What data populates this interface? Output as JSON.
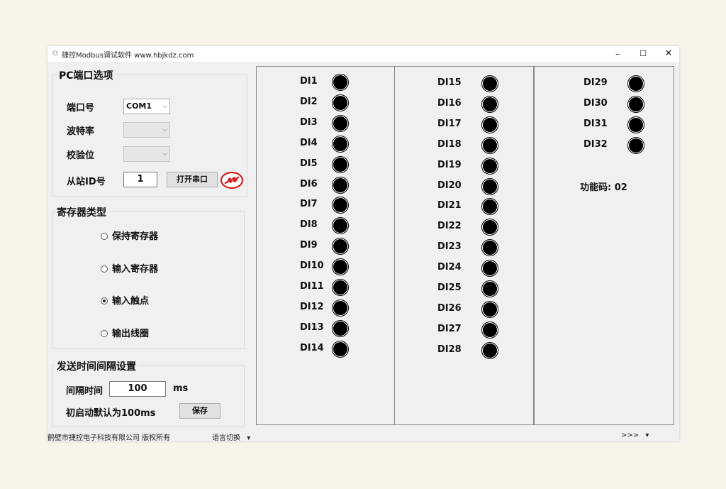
{
  "window": {
    "title": "捷控Modbus调试软件 www.hbjkdz.com",
    "icon": "app-icon",
    "controls": {
      "minimize": "–",
      "maximize": "☐",
      "close": "✕"
    }
  },
  "port_group": {
    "title": "PC端口选项",
    "port_label": "端口号",
    "port_value": "COM1",
    "baud_label": "波特率",
    "baud_value": "",
    "parity_label": "校验位",
    "parity_value": "",
    "slave_label": "从站ID号",
    "slave_value": "1",
    "open_button": "打开串口",
    "connection_icon": "disconnected-plug-icon"
  },
  "register_group": {
    "title": "寄存器类型",
    "options": [
      {
        "label": "保持寄存器",
        "checked": false
      },
      {
        "label": "输入寄存器",
        "checked": false
      },
      {
        "label": "输入触点",
        "checked": true
      },
      {
        "label": "输出线圈",
        "checked": false
      }
    ]
  },
  "interval_group": {
    "title": "发送时间间隔设置",
    "interval_label": "间隔时间",
    "interval_value": "100",
    "unit": "ms",
    "default_note": "初启动默认为100ms",
    "save_button": "保存"
  },
  "inputs": {
    "column1": [
      "DI1",
      "DI2",
      "DI3",
      "DI4",
      "DI5",
      "DI6",
      "DI7",
      "DI8",
      "DI9",
      "DI10",
      "DI11",
      "DI12",
      "DI13",
      "DI14"
    ],
    "column2": [
      "DI15",
      "DI16",
      "DI17",
      "DI18",
      "DI19",
      "DI20",
      "DI21",
      "DI22",
      "DI23",
      "DI24",
      "DI25",
      "DI26",
      "DI27",
      "DI28"
    ],
    "column3": [
      "DI29",
      "DI30",
      "DI31",
      "DI32"
    ],
    "led_color": "#000000"
  },
  "function_code": "功能码: 02",
  "statusbar": {
    "company": "鹤壁市捷控电子科技有限公司  版权所有",
    "language": "语言切换",
    "language_arrow": "▾",
    "more": ">>>",
    "more_arrow": "▾"
  },
  "colors": {
    "window_bg": "#f0f0f0",
    "page_bg": "#f8f4e9",
    "accent_red": "#d42020"
  }
}
